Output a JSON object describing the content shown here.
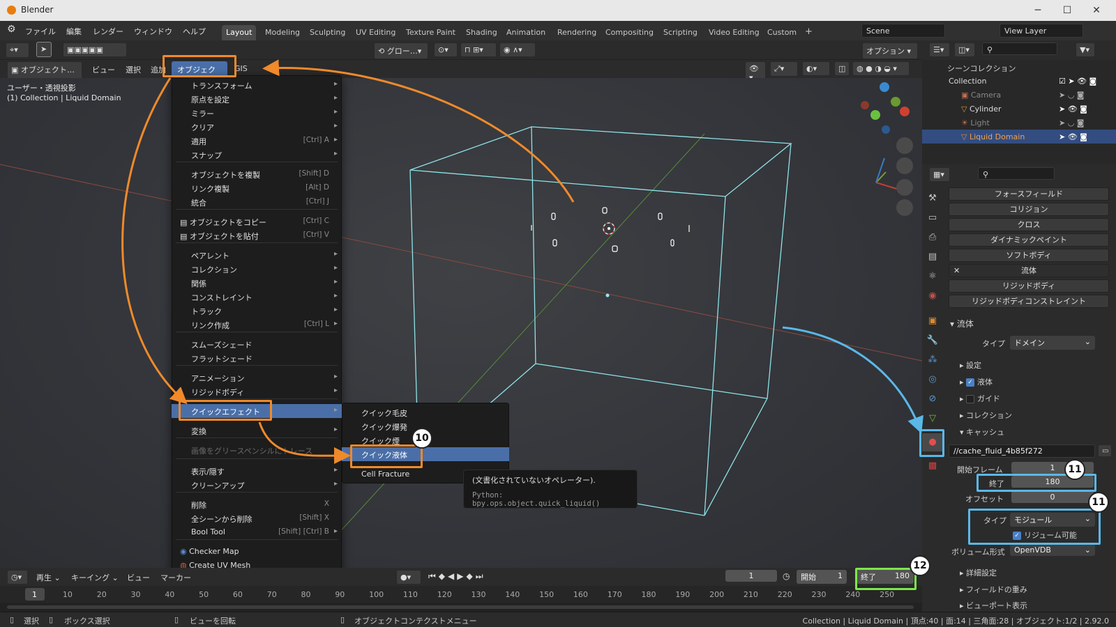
{
  "window": {
    "title": "Blender",
    "minimize": "─",
    "maximize": "☐",
    "close": "✕"
  },
  "menubar": {
    "items": [
      "ファイル",
      "編集",
      "レンダー",
      "ウィンドウ",
      "ヘルプ"
    ]
  },
  "workspaces": {
    "tabs": [
      "Layout",
      "Modeling",
      "Sculpting",
      "UV Editing",
      "Texture Paint",
      "Shading",
      "Animation",
      "Rendering",
      "Compositing",
      "Scripting",
      "Video Editing",
      "Custom"
    ],
    "add": "+",
    "active": "Layout"
  },
  "scene": {
    "label": "Scene",
    "view_layer": "View Layer"
  },
  "header": {
    "transform": "グロー…",
    "options": "オプション"
  },
  "header2": {
    "mode": "オブジェクト…",
    "view": "ビュー",
    "select": "選択",
    "add": "追加",
    "object": "オブジェクト",
    "gis": "GIS"
  },
  "viewport": {
    "projection": "ユーザー・透視投影",
    "context": "(1) Collection | Liquid Domain"
  },
  "object_menu": {
    "items": [
      {
        "label": "トランスフォーム",
        "shortcut": "",
        "arrow": "▸"
      },
      {
        "label": "原点を設定",
        "shortcut": "",
        "arrow": "▸"
      },
      {
        "label": "ミラー",
        "shortcut": "",
        "arrow": "▸"
      },
      {
        "label": "クリア",
        "shortcut": "",
        "arrow": "▸"
      },
      {
        "label": "適用",
        "shortcut": "[Ctrl] A",
        "arrow": "▸"
      },
      {
        "label": "スナップ",
        "shortcut": "",
        "arrow": "▸"
      },
      {
        "label": "オブジェクトを複製",
        "shortcut": "[Shift] D",
        "arrow": ""
      },
      {
        "label": "リンク複製",
        "shortcut": "[Alt] D",
        "arrow": ""
      },
      {
        "label": "統合",
        "shortcut": "[Ctrl] J",
        "arrow": ""
      },
      {
        "label": "オブジェクトをコピー",
        "shortcut": "[Ctrl] C",
        "arrow": ""
      },
      {
        "label": "オブジェクトを貼付",
        "shortcut": "[Ctrl] V",
        "arrow": ""
      },
      {
        "label": "ペアレント",
        "shortcut": "",
        "arrow": "▸"
      },
      {
        "label": "コレクション",
        "shortcut": "",
        "arrow": "▸"
      },
      {
        "label": "関係",
        "shortcut": "",
        "arrow": "▸"
      },
      {
        "label": "コンストレイント",
        "shortcut": "",
        "arrow": "▸"
      },
      {
        "label": "トラック",
        "shortcut": "",
        "arrow": "▸"
      },
      {
        "label": "リンク作成",
        "shortcut": "[Ctrl] L",
        "arrow": "▸"
      },
      {
        "label": "スムーズシェード",
        "shortcut": "",
        "arrow": ""
      },
      {
        "label": "フラットシェード",
        "shortcut": "",
        "arrow": ""
      },
      {
        "label": "アニメーション",
        "shortcut": "",
        "arrow": "▸"
      },
      {
        "label": "リジッドボディ",
        "shortcut": "",
        "arrow": "▸"
      },
      {
        "label": "クイックエフェクト",
        "shortcut": "",
        "arrow": "▸"
      },
      {
        "label": "変換",
        "shortcut": "",
        "arrow": "▸"
      },
      {
        "label": "画像をグリースペンシルにトレース",
        "shortcut": "",
        "arrow": ""
      },
      {
        "label": "表示/隠す",
        "shortcut": "",
        "arrow": "▸"
      },
      {
        "label": "クリーンアップ",
        "shortcut": "",
        "arrow": "▸"
      },
      {
        "label": "削除",
        "shortcut": "X",
        "arrow": ""
      },
      {
        "label": "全シーンから削除",
        "shortcut": "[Shift] X",
        "arrow": ""
      },
      {
        "label": "Bool Tool",
        "shortcut": "[Shift] [Ctrl] B",
        "arrow": "▸"
      },
      {
        "label": "Checker Map",
        "shortcut": "",
        "arrow": ""
      },
      {
        "label": "Create UV Mesh",
        "shortcut": "",
        "arrow": ""
      }
    ]
  },
  "quick_effects": {
    "items": [
      "クイック毛皮",
      "クイック爆発",
      "クイック煙",
      "クイック液体",
      "Cell Fracture"
    ]
  },
  "tooltip": {
    "line1": "(文書化されていないオペレーター).",
    "line2": "Python: bpy.ops.object.quick_liquid()"
  },
  "outliner": {
    "scene_collection": "シーンコレクション",
    "collection": "Collection",
    "objects": [
      "Camera",
      "Cylinder",
      "Light",
      "Liquid Domain"
    ]
  },
  "physics": {
    "buttons": [
      "フォースフィールド",
      "コリジョン",
      "クロス",
      "ダイナミックペイント",
      "ソフトボディ",
      "流体",
      "リジッドボディ",
      "リジッドボディコンストレイント"
    ],
    "fluid_panel": "流体",
    "type_label": "タイプ",
    "type_value": "ドメイン",
    "sub_settings": "設定",
    "sub_liquid": "液体",
    "sub_guide": "ガイド",
    "sub_collection": "コレクション",
    "sub_cache": "キャッシュ",
    "cache_path": "//cache_fluid_4b85f272",
    "start_frame_label": "開始フレーム",
    "start_frame": "1",
    "end_label": "終了",
    "end": "180",
    "offset_label": "オフセット",
    "offset": "0",
    "cache_type_label": "タイプ",
    "cache_type": "モジュール",
    "resumable": "リジューム可能",
    "volume_format_label": "ボリューム形式",
    "volume_format": "OpenVDB",
    "advanced": "詳細設定",
    "field_weights": "フィールドの重み",
    "viewport_display": "ビューポート表示"
  },
  "timeline": {
    "playback": "再生",
    "keying": "キーイング",
    "view": "ビュー",
    "marker": "マーカー",
    "current_frame": "1",
    "start_label": "開始",
    "start": "1",
    "end_label": "終了",
    "end": "180",
    "ticks": [
      "1",
      "10",
      "20",
      "30",
      "40",
      "50",
      "60",
      "70",
      "80",
      "90",
      "100",
      "110",
      "120",
      "130",
      "140",
      "150",
      "160",
      "170",
      "180",
      "190",
      "200",
      "210",
      "220",
      "230",
      "240",
      "250"
    ]
  },
  "statusbar": {
    "select": "選択",
    "box_select": "ボックス選択",
    "rotate_view": "ビューを回転",
    "context_menu": "オブジェクトコンテクストメニュー",
    "stats": "Collection | Liquid Domain | 頂点:40 | 面:14 | 三角面:28 | オブジェクト:1/2 | 2.92.0"
  },
  "badges": {
    "b10": "10",
    "b11a": "11",
    "b11b": "11",
    "b12": "12"
  },
  "colors": {
    "orange": "#f08a2a",
    "blue": "#5ab8e8",
    "green": "#7ce84a",
    "highlight": "#4a6fa8",
    "cube": "#8fe3e8"
  }
}
